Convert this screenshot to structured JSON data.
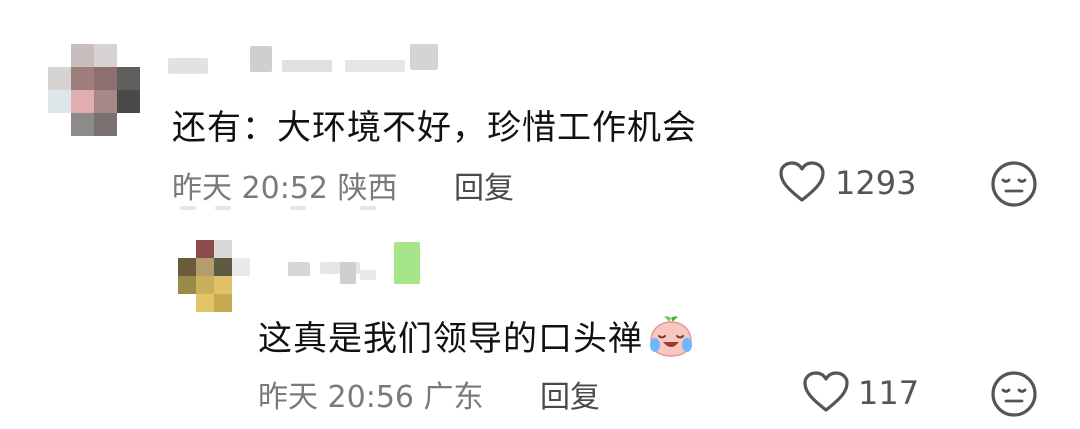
{
  "comments": [
    {
      "text": "还有：大环境不好，珍惜工作机会",
      "date": "昨天 20:52",
      "location": "陕西",
      "reply_label": "回复",
      "like_count": "1293"
    },
    {
      "text": "这真是我们领导的口头禅",
      "emoji": "crying-laughing-peach-emoji",
      "date": "昨天 20:56",
      "location": "广东",
      "reply_label": "回复",
      "like_count": "117"
    }
  ],
  "icons": {
    "like": "heart-outline-icon",
    "dislike": "meh-face-icon"
  },
  "colors": {
    "text": "#111111",
    "meta": "#7a7a7a",
    "icon": "#555555"
  }
}
